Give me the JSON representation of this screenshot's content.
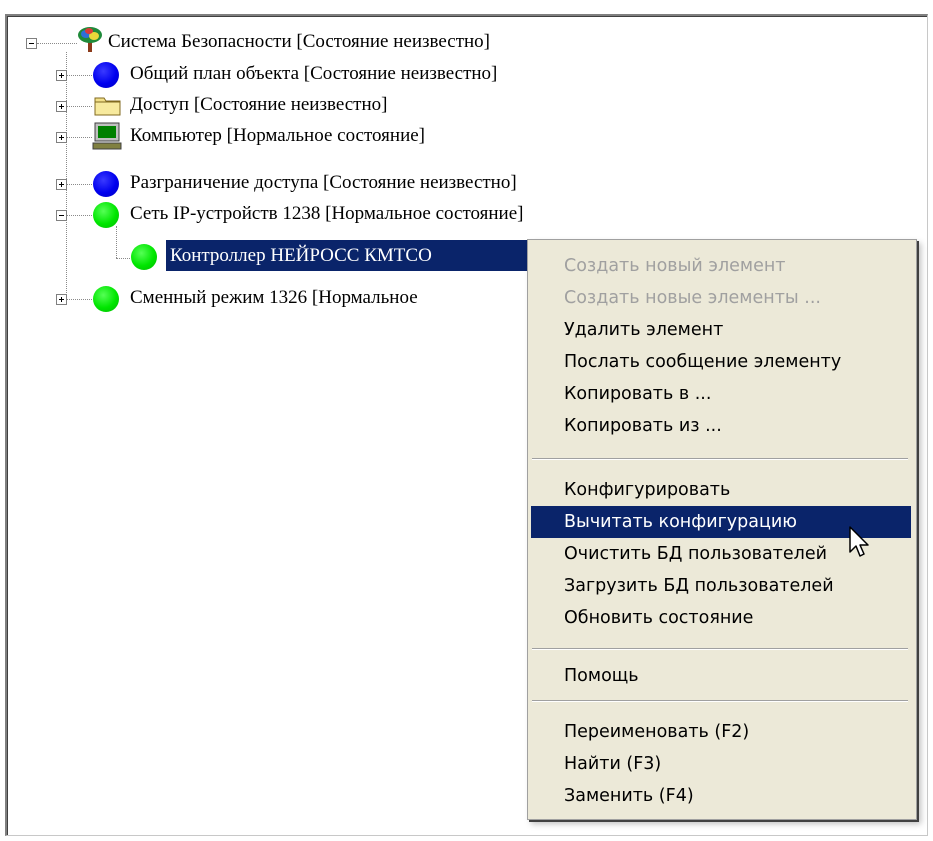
{
  "tree": {
    "items": [
      {
        "label": "Система Безопасности [Состояние неизвестно]",
        "icon": "security-system-tree-icon"
      },
      {
        "label": "Общий план объекта [Состояние неизвестно]",
        "icon": "blue-circle-icon"
      },
      {
        "label": "Доступ [Состояние неизвестно]",
        "icon": "folder-icon"
      },
      {
        "label": "Компьютер  [Нормальное состояние]",
        "icon": "computer-icon"
      },
      {
        "label": "Разграничение доступа [Состояние неизвестно]",
        "icon": "blue-circle-icon"
      },
      {
        "label": "Сеть IP-устройств 1238 [Нормальное состояние]",
        "icon": "green-circle-icon"
      },
      {
        "label": "Контроллер НЕЙРОСС КМТСО",
        "icon": "green-circle-icon"
      },
      {
        "label": "Сменный режим 1326 [Нормальное",
        "icon": "green-circle-icon"
      }
    ]
  },
  "context_menu": {
    "items": [
      "Создать новый элемент",
      "Создать новые элементы ...",
      "Удалить элемент",
      "Послать сообщение элементу",
      "Копировать в ...",
      "Копировать из ...",
      "Конфигурировать",
      "Вычитать конфигурацию",
      "Очистить БД пользователей",
      "Загрузить БД пользователей",
      "Обновить состояние",
      "Помощь",
      "Переименовать (F2)",
      "Найти (F3)",
      "Заменить (F4)"
    ]
  },
  "colors": {
    "selection": "#0a246a",
    "menu_background": "#ece9d8",
    "status_blue": "#0000ee",
    "status_green": "#00e600"
  }
}
